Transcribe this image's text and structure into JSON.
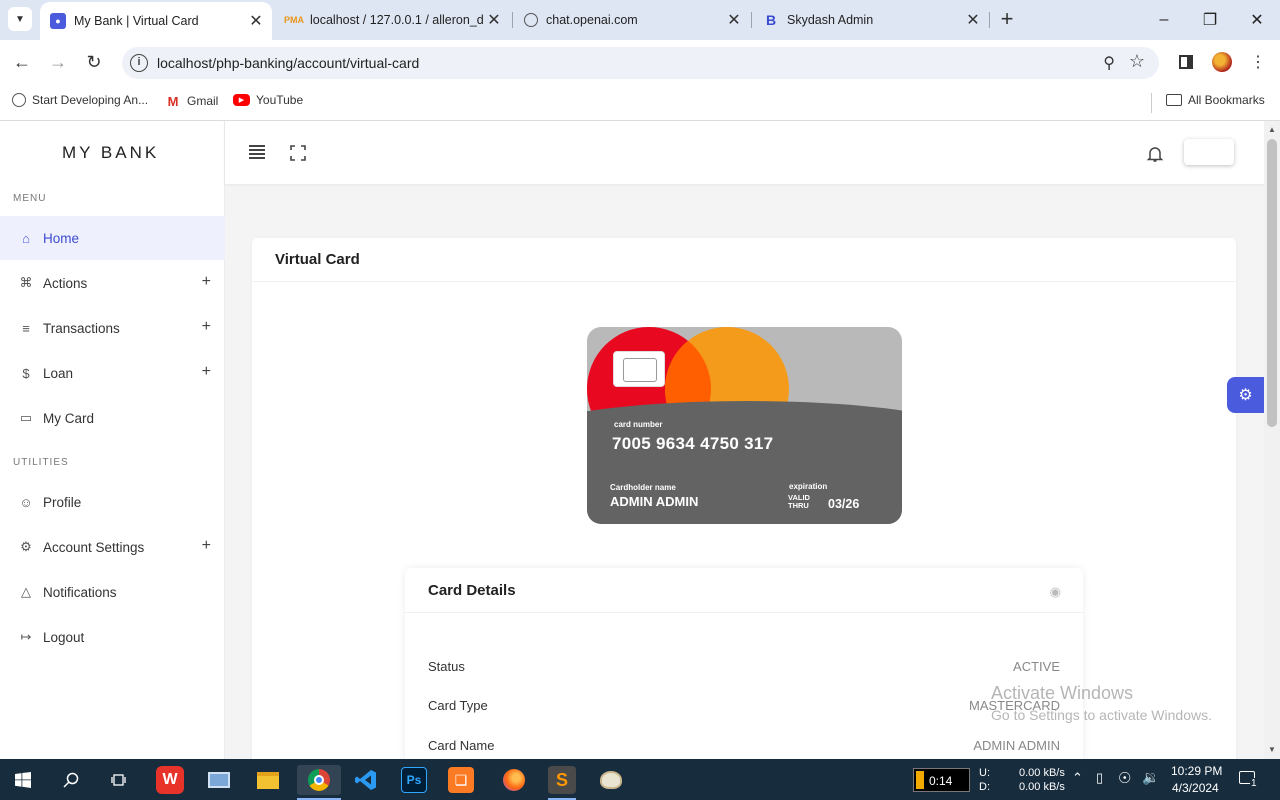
{
  "browser": {
    "tabs": [
      {
        "title": "My Bank | Virtual Card",
        "active": true
      },
      {
        "title": "localhost / 127.0.0.1 / alleron_d",
        "active": false
      },
      {
        "title": "chat.openai.com",
        "active": false
      },
      {
        "title": "Skydash Admin",
        "active": false
      }
    ],
    "url": "localhost/php-banking/account/virtual-card",
    "bookmarks": [
      {
        "label": "Start Developing An..."
      },
      {
        "label": "Gmail"
      },
      {
        "label": "YouTube"
      }
    ],
    "all_bookmarks": "All Bookmarks"
  },
  "app": {
    "logo": "MY BANK",
    "menu_label": "MENU",
    "utilities_label": "UTILITIES",
    "menu": [
      {
        "label": "Home",
        "icon": "home-icon",
        "active": true
      },
      {
        "label": "Actions",
        "icon": "command-icon",
        "expandable": true
      },
      {
        "label": "Transactions",
        "icon": "list-icon",
        "expandable": true
      },
      {
        "label": "Loan",
        "icon": "dollar-icon",
        "expandable": true
      },
      {
        "label": "My Card",
        "icon": "card-icon"
      }
    ],
    "utilities": [
      {
        "label": "Profile",
        "icon": "user-icon"
      },
      {
        "label": "Account Settings",
        "icon": "gear-icon",
        "expandable": true
      },
      {
        "label": "Notifications",
        "icon": "bell-icon"
      },
      {
        "label": "Logout",
        "icon": "logout-icon"
      }
    ],
    "accent_color": "#4b5bdd"
  },
  "page": {
    "title": "Virtual Card",
    "card": {
      "number_label": "card number",
      "number": "7005 9634 4750 317",
      "holder_label": "Cardholder name",
      "holder": "ADMIN ADMIN",
      "expiration_label": "expiration",
      "valid_thru": "VALID THRU",
      "expiration": "03/26"
    },
    "details": {
      "title": "Card Details",
      "rows": [
        {
          "key": "Status",
          "value": "ACTIVE"
        },
        {
          "key": "Card Type",
          "value": "MASTERCARD"
        },
        {
          "key": "Card Name",
          "value": "ADMIN ADMIN"
        }
      ]
    }
  },
  "watermark": {
    "title": "Activate Windows",
    "subtitle": "Go to Settings to activate Windows."
  },
  "taskbar": {
    "timer": "0:14",
    "net_up_label": "U:",
    "net_down_label": "D:",
    "net_up": "0.00 kB/s",
    "net_down": "0.00 kB/s",
    "time": "10:29 PM",
    "date": "4/3/2024",
    "notifications_count": "1"
  }
}
